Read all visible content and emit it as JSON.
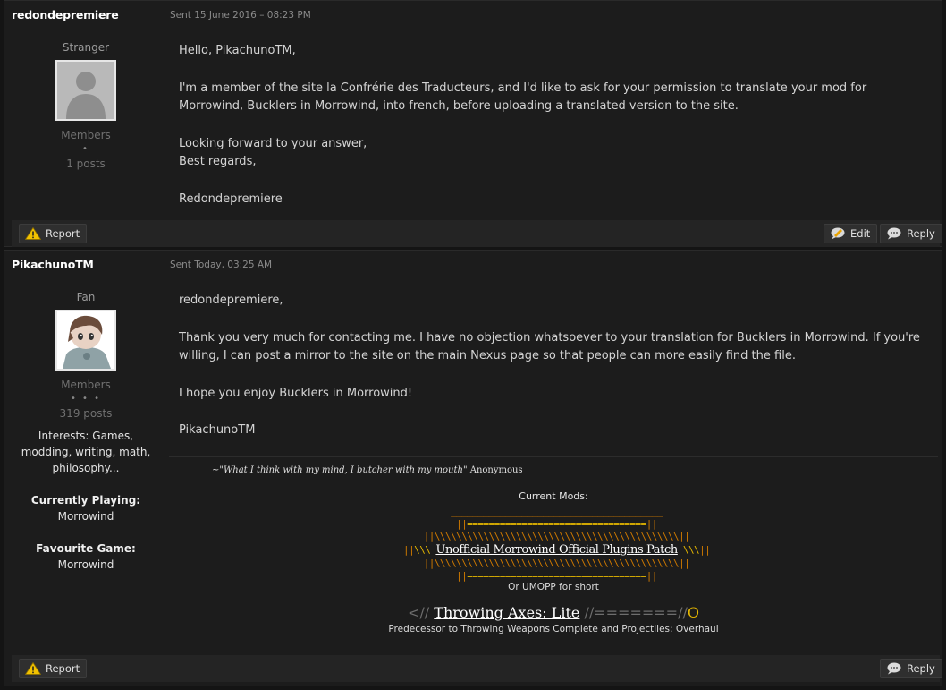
{
  "posts": [
    {
      "author": "redondepremiere",
      "sent": "Sent 15 June 2016 – 08:23 PM",
      "rank": "Stranger",
      "group": "Members",
      "pips": "•",
      "post_count": "1 posts",
      "body": [
        "Hello, PikachunoTM,",
        "I'm a member of the site la Confrérie des Traducteurs, and I'd like to ask for your permission to translate your mod for Morrowind, Bucklers in Morrowind, into french, before uploading a translated version to the site.",
        "Looking forward to your answer,\nBest regards,",
        "Redondepremiere"
      ],
      "buttons": {
        "report": "Report",
        "edit": "Edit",
        "reply": "Reply"
      }
    },
    {
      "author": "PikachunoTM",
      "sent": "Sent Today, 03:25 AM",
      "rank": "Fan",
      "group": "Members",
      "pips": "• • •",
      "post_count": "319 posts",
      "interests": "Interests: Games, modding, writing, math, philosophy...",
      "currently_playing_label": "Currently Playing:",
      "currently_playing": "Morrowind",
      "favourite_game_label": "Favourite Game:",
      "favourite_game": "Morrowind",
      "body": [
        "redondepremiere,",
        "Thank you very much for contacting me. I have no objection whatsoever to your translation for Bucklers in Morrowind. If you're willing, I can post a mirror to the site on the main Nexus page so that people can more easily find the file.",
        "I hope you enjoy Bucklers in Morrowind!",
        "PikachunoTM"
      ],
      "signature": {
        "quote_prefix": "~\"",
        "quote": "What I think with my mind, I butcher with my mouth",
        "quote_suffix": "\" Anonymous",
        "current_mods_label": "Current Mods:",
        "umopp_title": "Unofficial Morrowind Official Plugins Patch",
        "umopp_short": "Or UMOPP for short",
        "throwing_prefix": "<// ",
        "throwing_title": "Throwing Axes: Lite",
        "throwing_mid": " //=======//",
        "throwing_o": "O",
        "predecessor": "Predecessor to Throwing Weapons Complete and Projectiles: Overhaul"
      },
      "buttons": {
        "report": "Report",
        "reply": "Reply"
      }
    }
  ],
  "colors": {
    "background": "#141414",
    "panel": "#1c1c1c",
    "footer": "#242424",
    "accent_gold": "#e6b800",
    "accent_orange": "#d07a00"
  },
  "icons": [
    "warning-icon",
    "edit-bubble-icon",
    "reply-bubble-icon",
    "default-avatar-icon",
    "character-avatar-icon"
  ]
}
